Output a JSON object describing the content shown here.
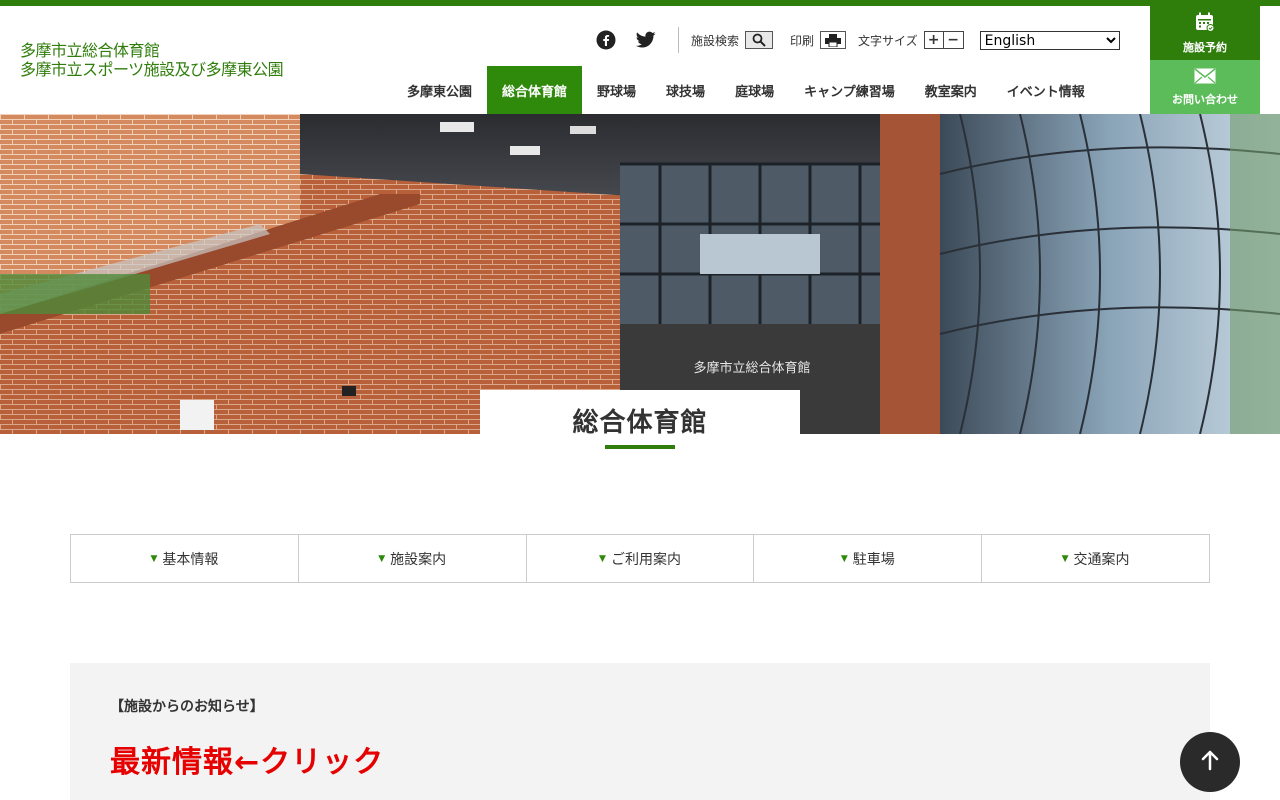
{
  "header": {
    "logo_line1": "多摩市立総合体育館",
    "logo_line2": "多摩市立スポーツ施設及び多摩東公園",
    "utility": {
      "facility_search_label": "施設検索",
      "print_label": "印刷",
      "font_size_label": "文字サイズ",
      "font_plus": "+",
      "font_minus": "−",
      "language_selected": "English"
    },
    "nav": [
      {
        "label": "多摩東公園"
      },
      {
        "label": "総合体育館",
        "active": true
      },
      {
        "label": "野球場"
      },
      {
        "label": "球技場"
      },
      {
        "label": "庭球場"
      },
      {
        "label": "キャンプ練習場"
      },
      {
        "label": "教室案内"
      },
      {
        "label": "イベント情報"
      }
    ],
    "reserve_label": "施設予約",
    "contact_label": "お問い合わせ"
  },
  "hero": {
    "title": "総合体育館",
    "signage": "多摩市立総合体育館"
  },
  "tabs": [
    {
      "label": "基本情報"
    },
    {
      "label": "施設案内"
    },
    {
      "label": "ご利用案内"
    },
    {
      "label": "駐車場"
    },
    {
      "label": "交通案内"
    }
  ],
  "notice": {
    "heading": "【施設からのお知らせ】",
    "link_text": "最新情報←クリック"
  },
  "colors": {
    "brand_green": "#2f7d0a",
    "nav_active": "#2f8a0c",
    "contact_green": "#5cbc5a",
    "notice_red": "#e60000"
  },
  "icons": [
    "facebook-icon",
    "twitter-icon",
    "search-icon",
    "printer-icon",
    "calendar-icon",
    "mail-icon",
    "arrow-up-icon",
    "triangle-down-icon"
  ]
}
